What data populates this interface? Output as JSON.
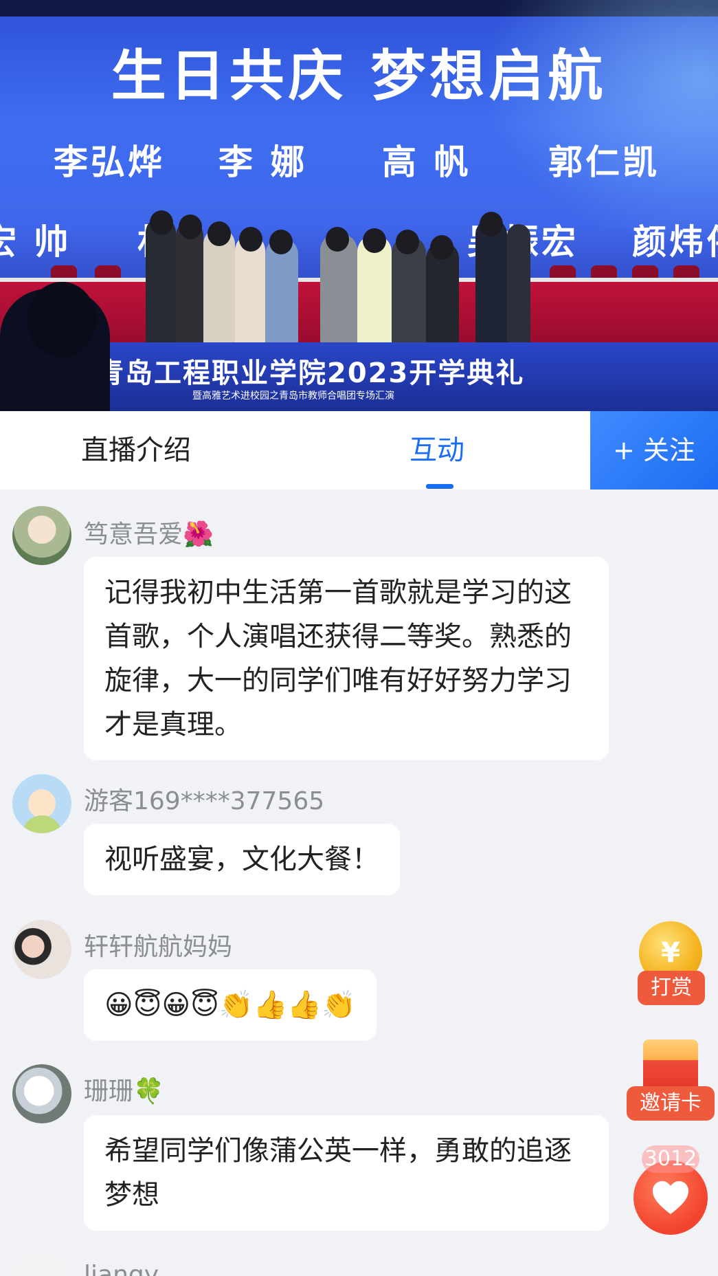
{
  "video": {
    "banner_title": "生日共庆  梦想启航",
    "names_row1": [
      "李弘烨",
      "李  娜",
      "高  帆",
      "郭仁凯"
    ],
    "names_row2": [
      "宏  帅",
      "杉",
      "吴振宏",
      "颜炜伟"
    ],
    "school_title": "青岛工程职业学院2023开学典礼",
    "school_subtitle": "暨高雅艺术进校园之青岛市教师合唱团专场汇演"
  },
  "tabs": {
    "intro_label": "直播介绍",
    "interact_label": "互动",
    "follow_label": "+ 关注",
    "active": "互动"
  },
  "messages": [
    {
      "username": "笃意吾爱🌺",
      "text": "记得我初中生活第一首歌就是学习的这首歌，个人演唱还获得二等奖。熟悉的旋律，大一的同学们唯有好好努力学习才是真理。",
      "avatar_icon": "user-photo-avatar"
    },
    {
      "username": "游客169****377565",
      "text": "视听盛宴，文化大餐！",
      "avatar_icon": "guest-default-avatar"
    },
    {
      "username": "轩轩航航妈妈",
      "text": "😀😇😀😇👏👍👍👏",
      "avatar_icon": "user-photo-avatar"
    },
    {
      "username": "珊珊🍀",
      "text": "希望同学们像蒲公英一样，勇敢的追逐梦想",
      "avatar_icon": "user-photo-avatar"
    },
    {
      "username": "liangy",
      "text": "",
      "avatar_icon": "user-photo-avatar"
    }
  ],
  "floating": {
    "reward_coin_symbol": "¥",
    "reward_label": "打赏",
    "invite_label": "邀请卡",
    "like_count": "3012",
    "like_icon": "heart-icon"
  },
  "colors": {
    "accent_blue": "#1a6ef5",
    "reward_red": "#f05a3c",
    "background": "#f1f2f6"
  }
}
